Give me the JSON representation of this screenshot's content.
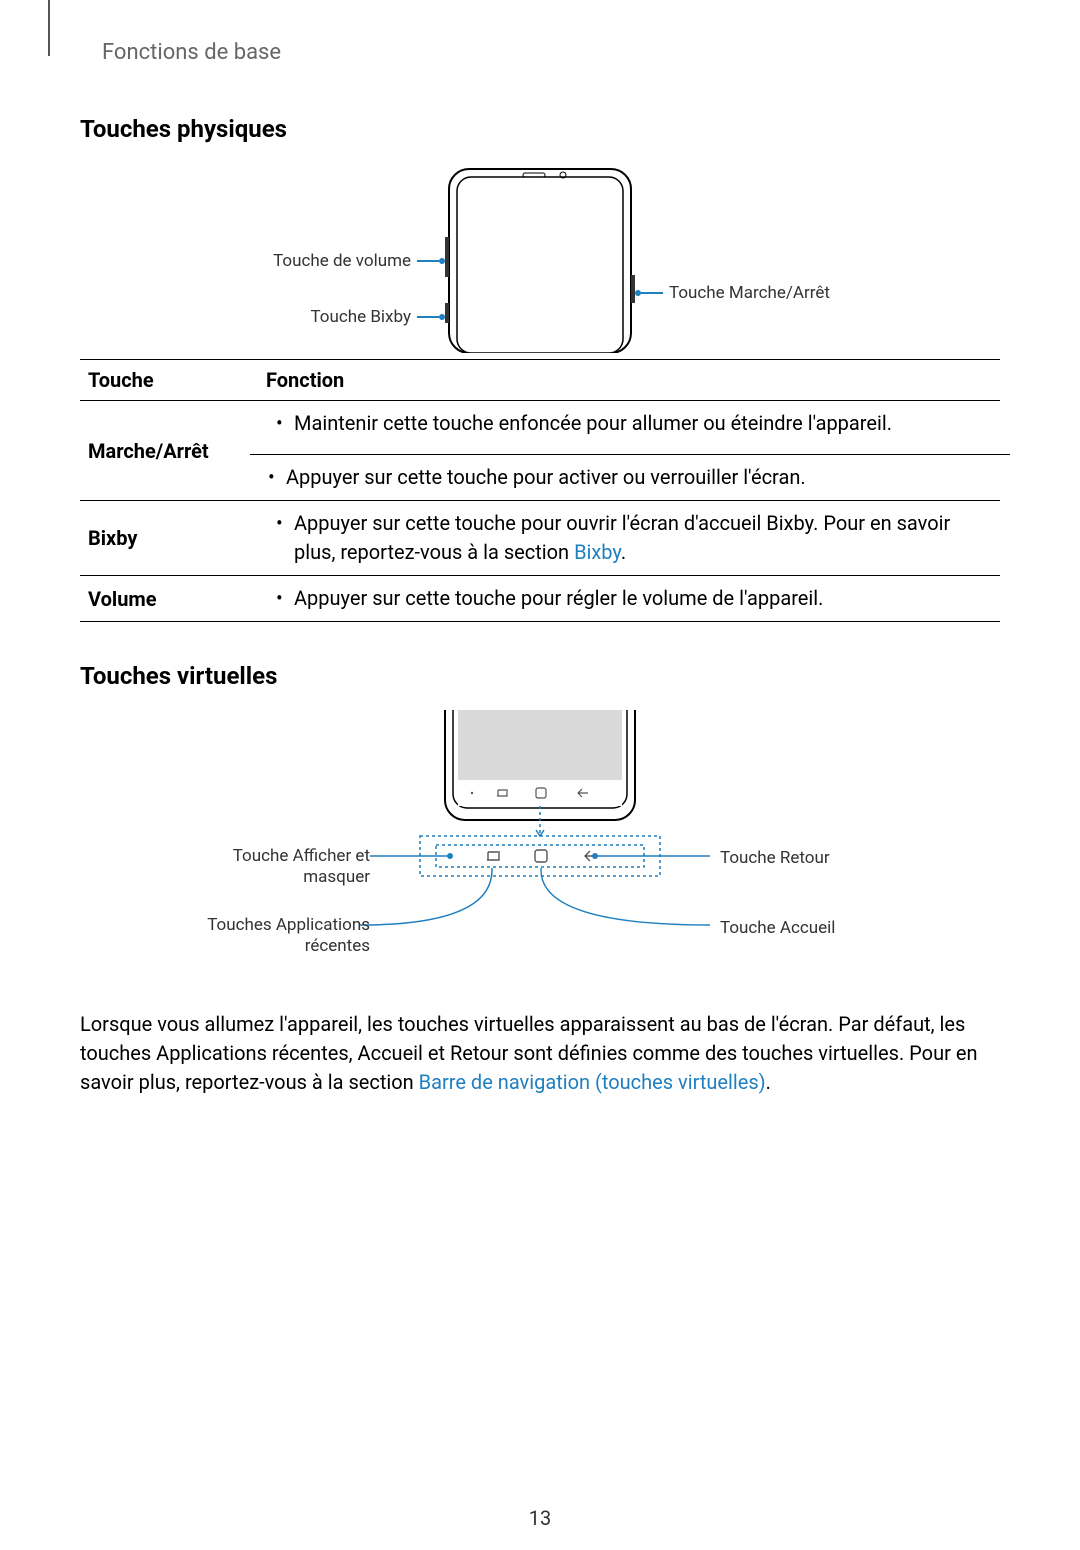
{
  "breadcrumb": "Fonctions de base",
  "section1": {
    "title": "Touches physiques",
    "callouts": {
      "volume": "Touche de volume",
      "bixby": "Touche Bixby",
      "power": "Touche Marche/Arrêt"
    }
  },
  "table": {
    "headers": {
      "key": "Touche",
      "fn": "Fonction"
    },
    "rows": [
      {
        "key": "Marche/Arrêt",
        "items": [
          "Maintenir cette touche enfoncée pour allumer ou éteindre l'appareil.",
          "Appuyer sur cette touche pour activer ou verrouiller l'écran."
        ]
      },
      {
        "key": "Bixby",
        "items_prefix": "Appuyer sur cette touche pour ouvrir l'écran d'accueil Bixby. Pour en savoir plus, reportez-vous à la section ",
        "items_link": "Bixby",
        "items_suffix": "."
      },
      {
        "key": "Volume",
        "items": [
          "Appuyer sur cette touche pour régler le volume de l'appareil."
        ]
      }
    ]
  },
  "section2": {
    "title": "Touches virtuelles",
    "labels": {
      "showhide": "Touche Afficher et masquer",
      "recents": "Touches Applications récentes",
      "back": "Touche Retour",
      "home": "Touche Accueil"
    }
  },
  "paragraph": {
    "before": "Lorsque vous allumez l'appareil, les touches virtuelles apparaissent au bas de l'écran. Par défaut, les touches Applications récentes, Accueil et Retour sont définies comme des touches virtuelles. Pour en savoir plus, reportez-vous à la section ",
    "link": "Barre de navigation (touches virtuelles)",
    "after": "."
  },
  "page_number": "13"
}
